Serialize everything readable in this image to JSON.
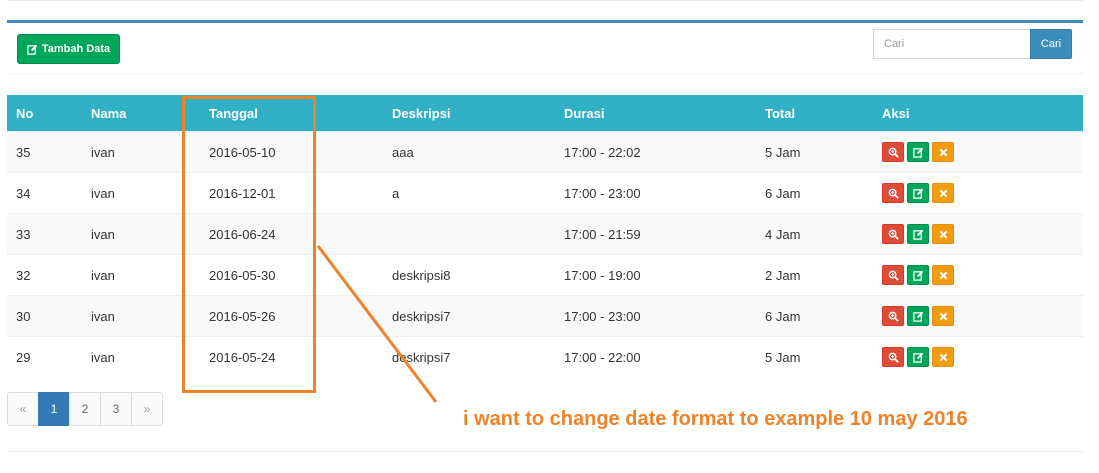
{
  "toolbar": {
    "add_label": "Tambah Data"
  },
  "search": {
    "placeholder": "Cari",
    "button_label": "Cari"
  },
  "table": {
    "headers": [
      "No",
      "Nama",
      "Tanggal",
      "Deskripsi",
      "Durasi",
      "Total",
      "Aksi"
    ],
    "rows": [
      [
        "35",
        "ivan",
        "2016-05-10",
        "aaa",
        "17:00 - 22:02",
        "5 Jam"
      ],
      [
        "34",
        "ivan",
        "2016-12-01",
        "a",
        "17:00 - 23:00",
        "6 Jam"
      ],
      [
        "33",
        "ivan",
        "2016-06-24",
        "",
        "17:00 - 21:59",
        "4 Jam"
      ],
      [
        "32",
        "ivan",
        "2016-05-30",
        "deskripsi8",
        "17:00 - 19:00",
        "2 Jam"
      ],
      [
        "30",
        "ivan",
        "2016-05-26",
        "deskripsi7",
        "17:00 - 23:00",
        "6 Jam"
      ],
      [
        "29",
        "ivan",
        "2016-05-24",
        "deskripsi7",
        "17:00 - 22:00",
        "5 Jam"
      ]
    ]
  },
  "pagination": {
    "prev": "«",
    "pages": [
      "1",
      "2",
      "3"
    ],
    "next": "»",
    "active": "1"
  },
  "annotation": {
    "text": "i want to change date format to example 10 may 2016",
    "color": "#f0822a"
  },
  "icons": {
    "add": "edit-icon",
    "view": "zoom-in-icon",
    "edit": "edit-icon",
    "delete": "close-icon"
  },
  "colors": {
    "header_bg": "#31b0c5",
    "add_button": "#00a65a",
    "search_button": "#3c8dbc",
    "view_button": "#dd4b39",
    "edit_button": "#00a65a",
    "delete_button": "#f39c12",
    "active_page": "#337ab7"
  }
}
